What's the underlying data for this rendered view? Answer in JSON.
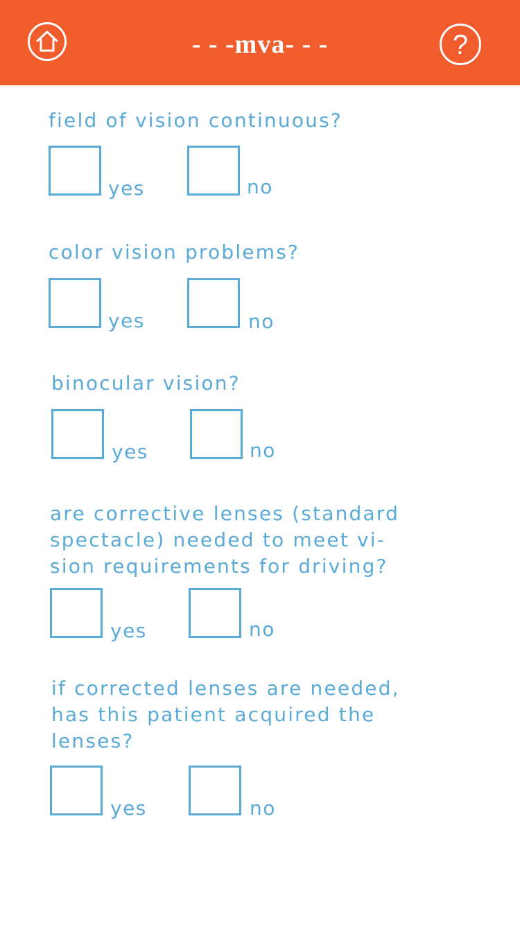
{
  "header": {
    "title": "- - -mva- - -",
    "home_icon": "home-icon",
    "help_icon": "question-mark-icon",
    "help_glyph": "?",
    "accent": "#f15c2d",
    "text_color": "#ffffff"
  },
  "questions": [
    {
      "text": [
        "field of vision continuous?"
      ],
      "yes": "yes",
      "no": "no"
    },
    {
      "text": [
        "color vision problems?"
      ],
      "yes": "yes",
      "no": "no"
    },
    {
      "text": [
        "binocular vision?"
      ],
      "yes": "yes",
      "no": "no"
    },
    {
      "text": [
        "are corrective lenses (standard",
        "spectacle) needed to meet vi-",
        "sion requirements for driving?"
      ],
      "yes": "yes",
      "no": "no"
    },
    {
      "text": [
        "if corrected lenses are needed,",
        "has this patient acquired the",
        "lenses?"
      ],
      "yes": "yes",
      "no": "no"
    }
  ],
  "colors": {
    "question_text": "#5aaad8",
    "checkbox_border": "#5aaad8",
    "background": "#ffffff"
  }
}
